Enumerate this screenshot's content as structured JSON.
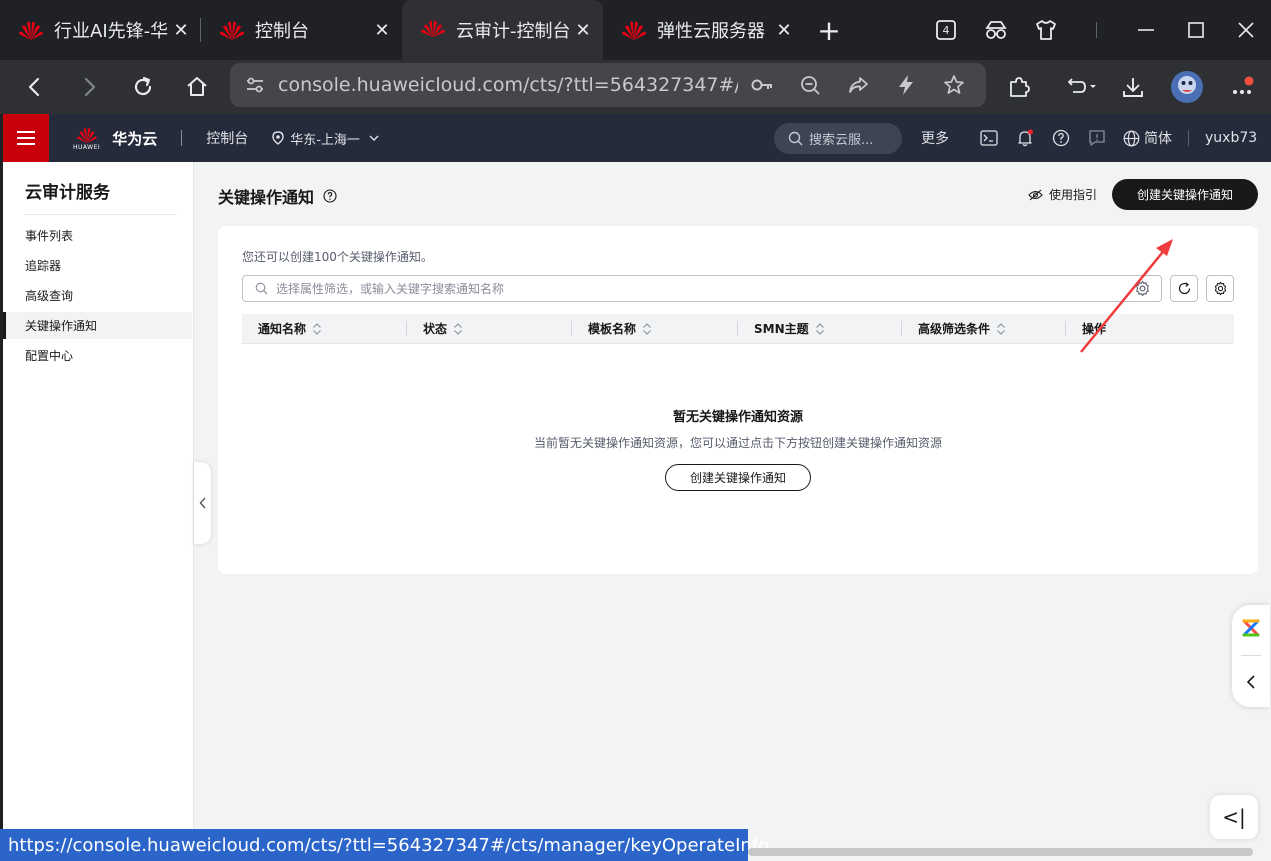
{
  "browser": {
    "tabs": [
      {
        "title": "行业AI先锋-华"
      },
      {
        "title": "控制台"
      },
      {
        "title": "云审计-控制台"
      },
      {
        "title": "弹性云服务器"
      }
    ],
    "new_tab": "+",
    "tab_count": "4",
    "url": "console.huaweicloud.com/cts/?ttl=564327347#/cts..."
  },
  "header": {
    "brand": "华为云",
    "logo_text": "HUAWEI",
    "console": "控制台",
    "region": "华东-上海一",
    "search_placeholder": "搜索云服...",
    "more": "更多",
    "language": "简体",
    "user": "yuxb73"
  },
  "sidebar": {
    "title": "云审计服务",
    "items": [
      {
        "label": "事件列表"
      },
      {
        "label": "追踪器"
      },
      {
        "label": "高级查询"
      },
      {
        "label": "关键操作通知"
      },
      {
        "label": "配置中心"
      }
    ]
  },
  "main": {
    "title": "关键操作通知",
    "guide": "使用指引",
    "create_button": "创建关键操作通知",
    "quota": "您还可以创建100个关键操作通知。",
    "filter_placeholder": "选择属性筛选，或输入关键字搜索通知名称",
    "columns": [
      {
        "label": "通知名称"
      },
      {
        "label": "状态"
      },
      {
        "label": "模板名称"
      },
      {
        "label": "SMN主题"
      },
      {
        "label": "高级筛选条件"
      },
      {
        "label": "操作"
      }
    ],
    "empty_title": "暂无关键操作通知资源",
    "empty_desc": "当前暂无关键操作通知资源，您可以通过点击下方按钮创建关键操作通知资源",
    "empty_button": "创建关键操作通知"
  },
  "float_button": "<|",
  "status_url": "https://console.huaweicloud.com/cts/?ttl=564327347#/cts/manager/keyOperateInfo",
  "colors": {
    "accent_red": "#c7000b",
    "header_bg": "#252b3a",
    "primary_button": "#191919",
    "annotation_arrow": "#f03c3c",
    "status_bar": "#2b65c9"
  }
}
